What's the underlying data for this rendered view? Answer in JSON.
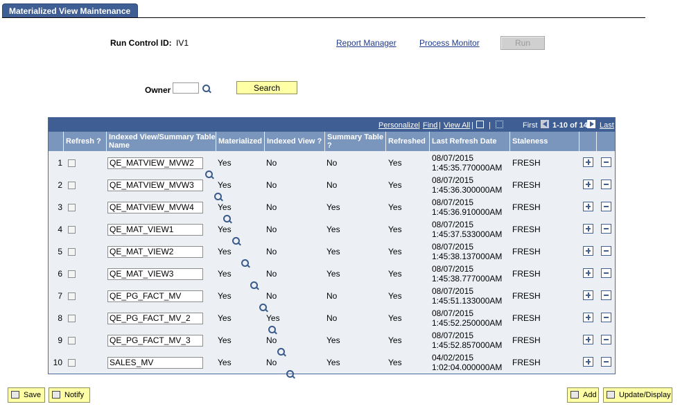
{
  "tab": {
    "label": "Materialized View Maintenance"
  },
  "run_control": {
    "label": "Run Control ID:",
    "value": "IV1"
  },
  "links": {
    "report_manager": "Report Manager",
    "process_monitor": "Process Monitor"
  },
  "run_button": "Run",
  "owner": {
    "label": "Owner",
    "value": ""
  },
  "search_button": "Search",
  "grid_nav": {
    "personalize": "Personalize",
    "find": "Find",
    "view_all": "View All",
    "first": "First",
    "range": "1-10 of 14",
    "last": "Last"
  },
  "columns": {
    "refresh": "Refresh ?",
    "name": "Indexed View/Summary Table Name",
    "materialized": "Materialized",
    "indexed_view": "Indexed View ?",
    "summary_table": "Summary Table ?",
    "refreshed": "Refreshed",
    "last_refresh_date": "Last Refresh Date",
    "staleness": "Staleness"
  },
  "rows": [
    {
      "num": "1",
      "name": "QE_MATVIEW_MVW2",
      "materialized": "Yes",
      "indexed_view": "No",
      "summary_table": "No",
      "refreshed": "Yes",
      "date": "08/07/2015",
      "time": "1:45:35.770000AM",
      "staleness": "FRESH"
    },
    {
      "num": "2",
      "name": "QE_MATVIEW_MVW3",
      "materialized": "Yes",
      "indexed_view": "No",
      "summary_table": "No",
      "refreshed": "Yes",
      "date": "08/07/2015",
      "time": "1:45:36.300000AM",
      "staleness": "FRESH"
    },
    {
      "num": "3",
      "name": "QE_MATVIEW_MVW4",
      "materialized": "Yes",
      "indexed_view": "No",
      "summary_table": "Yes",
      "refreshed": "Yes",
      "date": "08/07/2015",
      "time": "1:45:36.910000AM",
      "staleness": "FRESH"
    },
    {
      "num": "4",
      "name": "QE_MAT_VIEW1",
      "materialized": "Yes",
      "indexed_view": "No",
      "summary_table": "Yes",
      "refreshed": "Yes",
      "date": "08/07/2015",
      "time": "1:45:37.533000AM",
      "staleness": "FRESH"
    },
    {
      "num": "5",
      "name": "QE_MAT_VIEW2",
      "materialized": "Yes",
      "indexed_view": "No",
      "summary_table": "Yes",
      "refreshed": "Yes",
      "date": "08/07/2015",
      "time": "1:45:38.137000AM",
      "staleness": "FRESH"
    },
    {
      "num": "6",
      "name": "QE_MAT_VIEW3",
      "materialized": "Yes",
      "indexed_view": "No",
      "summary_table": "Yes",
      "refreshed": "Yes",
      "date": "08/07/2015",
      "time": "1:45:38.777000AM",
      "staleness": "FRESH"
    },
    {
      "num": "7",
      "name": "QE_PG_FACT_MV",
      "materialized": "Yes",
      "indexed_view": "No",
      "summary_table": "No",
      "refreshed": "Yes",
      "date": "08/07/2015",
      "time": "1:45:51.133000AM",
      "staleness": "FRESH"
    },
    {
      "num": "8",
      "name": "QE_PG_FACT_MV_2",
      "materialized": "Yes",
      "indexed_view": "Yes",
      "summary_table": "No",
      "refreshed": "Yes",
      "date": "08/07/2015",
      "time": "1:45:52.250000AM",
      "staleness": "FRESH"
    },
    {
      "num": "9",
      "name": "QE_PG_FACT_MV_3",
      "materialized": "Yes",
      "indexed_view": "No",
      "summary_table": "Yes",
      "refreshed": "Yes",
      "date": "08/07/2015",
      "time": "1:45:52.857000AM",
      "staleness": "FRESH"
    },
    {
      "num": "10",
      "name": "SALES_MV",
      "materialized": "Yes",
      "indexed_view": "No",
      "summary_table": "Yes",
      "refreshed": "Yes",
      "date": "04/02/2015",
      "time": "1:02:04.000000AM",
      "staleness": "FRESH"
    }
  ],
  "bottom_buttons": {
    "save": "Save",
    "notify": "Notify",
    "add": "Add",
    "update_display": "Update/Display"
  }
}
